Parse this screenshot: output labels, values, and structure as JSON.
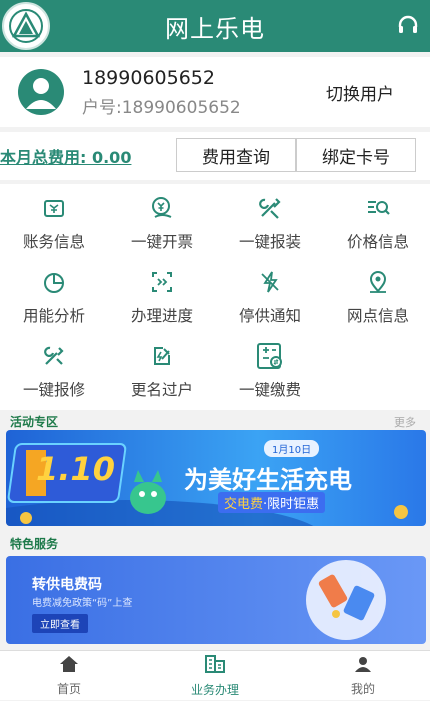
{
  "header": {
    "title": "网上乐电"
  },
  "user": {
    "phone": "18990605652",
    "account": "户号:18990605652",
    "switch_label": "切换用户"
  },
  "fee": {
    "label": "本月总费用: 0.00",
    "query_button": "费用查询",
    "bind_button": "绑定卡号"
  },
  "services": [
    {
      "label": "账务信息",
      "icon": "bill-icon"
    },
    {
      "label": "一键开票",
      "icon": "invoice-icon"
    },
    {
      "label": "一键报装",
      "icon": "tools-icon"
    },
    {
      "label": "价格信息",
      "icon": "price-search-icon"
    },
    {
      "label": "用能分析",
      "icon": "pie-chart-icon"
    },
    {
      "label": "办理进度",
      "icon": "progress-icon"
    },
    {
      "label": "停供通知",
      "icon": "power-off-icon"
    },
    {
      "label": "网点信息",
      "icon": "location-icon"
    },
    {
      "label": "一键报修",
      "icon": "repair-icon"
    },
    {
      "label": "更名过户",
      "icon": "transfer-icon"
    },
    {
      "label": "一键缴费",
      "icon": "payment-icon"
    }
  ],
  "sections": {
    "activity_title": "活动专区",
    "more": "更多",
    "featured_title": "特色服务"
  },
  "banner1": {
    "badge": "1.10",
    "date": "1月10日",
    "headline": "为美好生活充电",
    "sub1": "交电费",
    "sub2": "·限时钜惠"
  },
  "banner2": {
    "title": "转供电费码",
    "subtitle": "电费减免政策“码”上查",
    "button": "立即查看"
  },
  "tabs": [
    {
      "label": "首页",
      "icon": "home-icon"
    },
    {
      "label": "业务办理",
      "icon": "business-icon"
    },
    {
      "label": "我的",
      "icon": "profile-icon"
    }
  ],
  "colors": {
    "primary": "#2a8a76",
    "accent": "#1e7a4a"
  }
}
